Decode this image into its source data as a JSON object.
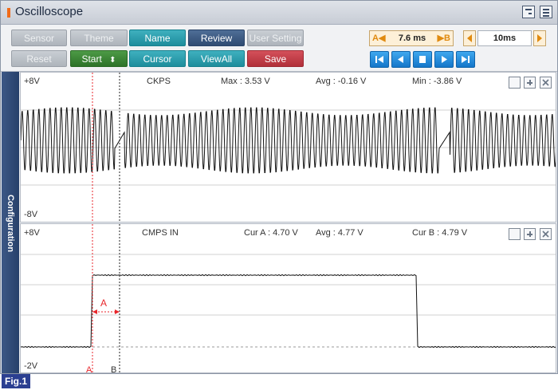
{
  "window": {
    "title": "Oscilloscope"
  },
  "toolbar": {
    "sensor": "Sensor",
    "theme": "Theme",
    "name": "Name",
    "review": "Review",
    "user_setting": "User Setting",
    "reset": "Reset",
    "start": "Start",
    "start_arrows": "⬍",
    "cursor": "Cursor",
    "viewall": "ViewAll",
    "save": "Save",
    "cursor_a": "A◀",
    "cursor_value": "7.6 ms",
    "cursor_b": "▶B",
    "time_div": "10ms"
  },
  "sidebar": {
    "label": "Configuration"
  },
  "channel1": {
    "name": "CKPS",
    "top": "+8V",
    "bottom": "-8V",
    "max": "Max : 3.53 V",
    "avg": "Avg : -0.16 V",
    "min": "Min : -3.86 V"
  },
  "channel2": {
    "name": "CMPS IN",
    "top": "+8V",
    "bottom": "-2V",
    "cur_a": "Cur A : 4.70 V",
    "avg": "Avg : 4.77 V",
    "cur_b": "Cur B : 4.79 V",
    "marker_a": "A",
    "marker_b": "B",
    "interval_label": "A"
  },
  "figure": {
    "label": "Fig.1"
  },
  "colors": {
    "cursor_a": "#e8262b",
    "cursor_b": "#222222",
    "accent": "#f06b19"
  }
}
